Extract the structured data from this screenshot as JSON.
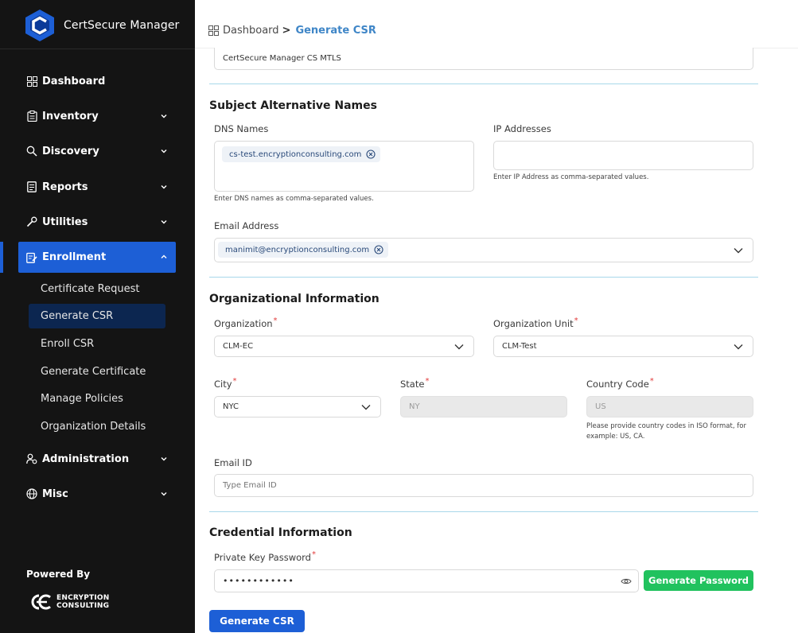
{
  "app": {
    "title": "CertSecure Manager"
  },
  "sidebar": {
    "items": [
      {
        "label": "Dashboard"
      },
      {
        "label": "Inventory"
      },
      {
        "label": "Discovery"
      },
      {
        "label": "Reports"
      },
      {
        "label": "Utilities"
      },
      {
        "label": "Enrollment"
      },
      {
        "label": "Administration"
      },
      {
        "label": "Misc"
      }
    ],
    "enrollment_sub": [
      {
        "label": "Certificate Request"
      },
      {
        "label": "Generate CSR"
      },
      {
        "label": "Enroll CSR"
      },
      {
        "label": "Generate Certificate"
      },
      {
        "label": "Manage Policies"
      },
      {
        "label": "Organization Details"
      }
    ],
    "powered_by": "Powered By",
    "vendor_line1": "ENCRYPTION",
    "vendor_line2": "CONSULTING"
  },
  "breadcrumb": {
    "root": "Dashboard",
    "separator": ">",
    "current": "Generate CSR"
  },
  "common_name_value": "CertSecure Manager CS MTLS",
  "san": {
    "title": "Subject Alternative Names",
    "dns_label": "DNS Names",
    "dns_tag": "cs-test.encryptionconsulting.com",
    "dns_help": "Enter DNS names as comma-separated values.",
    "ip_label": "IP Addresses",
    "ip_help": "Enter IP Address as comma-separated values.",
    "email_label": "Email Address",
    "email_tag": "manimit@encryptionconsulting.com"
  },
  "org": {
    "title": "Organizational Information",
    "organization_label": "Organization",
    "organization_value": "CLM-EC",
    "unit_label": "Organization Unit",
    "unit_value": "CLM-Test",
    "city_label": "City",
    "city_value": "NYC",
    "state_label": "State",
    "state_value": "NY",
    "country_label": "Country Code",
    "country_value": "US",
    "country_help": "Please provide country codes in ISO format, for example: US, CA.",
    "email_id_label": "Email ID",
    "email_id_placeholder": "Type Email ID",
    "required_mark": "*"
  },
  "cred": {
    "title": "Credential Information",
    "password_label": "Private Key Password",
    "password_value": "••••••••••••",
    "generate_password": "Generate Password"
  },
  "submit": {
    "label": "Generate CSR"
  },
  "colors": {
    "accent": "#1d5fd6",
    "success": "#21c25e",
    "sidebar_bg": "#141414",
    "link": "#3f86c7"
  }
}
